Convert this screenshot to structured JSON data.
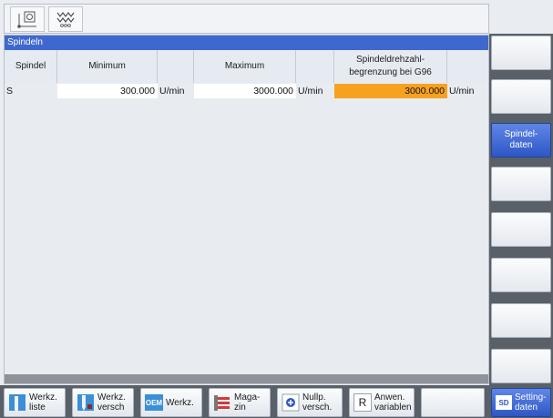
{
  "panel": {
    "title": "Spindeln"
  },
  "table": {
    "headers": [
      "Spindel",
      "Minimum",
      "Maximum",
      "Spindeldrehzahl-\nbegrenzung bei G96"
    ],
    "rows": [
      {
        "spindle": "S",
        "min": "300.000",
        "min_unit": "U/min",
        "max": "3000.000",
        "max_unit": "U/min",
        "limit": "3000.000",
        "limit_unit": "U/min"
      }
    ]
  },
  "vertical_softkeys": [
    "",
    "",
    "Spindel-\ndaten",
    "",
    "",
    "",
    "",
    ""
  ],
  "vertical_softkey_active_index": 2,
  "horizontal_softkeys": [
    {
      "label": "Werkz.\nliste",
      "icon": "tool-list-icon"
    },
    {
      "label": "Werkz.\nversch",
      "icon": "tool-offset-icon"
    },
    {
      "label": "Werkz.",
      "icon": "oem-icon",
      "icon_text": "OEM"
    },
    {
      "label": "Maga-\nzin",
      "icon": "magazine-icon"
    },
    {
      "label": "Nullp.\nversch.",
      "icon": "work-offset-icon"
    },
    {
      "label": "Anwen.\nvariablen",
      "icon": "user-variables-icon",
      "icon_text": "R"
    },
    {
      "label": "",
      "icon": ""
    },
    {
      "label": "Setting-\ndaten",
      "icon": "setting-data-icon",
      "icon_text": "SD",
      "active": true
    }
  ],
  "colors": {
    "title_bar": "#3f68cf",
    "highlight": "#f7a120",
    "softkey_active": "#2e57c5",
    "softkey_bg": "#5a6068"
  }
}
